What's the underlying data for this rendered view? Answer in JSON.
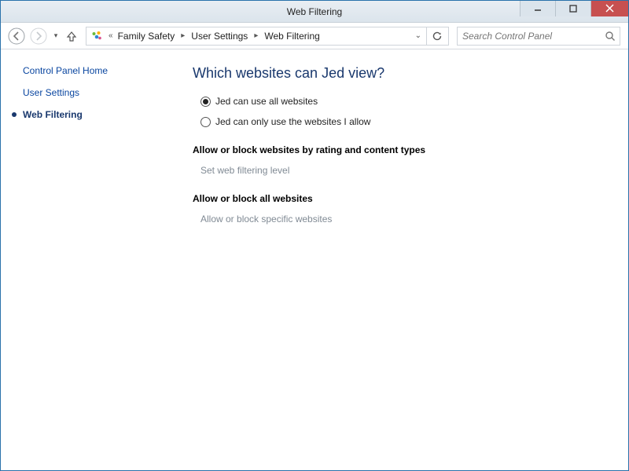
{
  "window": {
    "title": "Web Filtering"
  },
  "breadcrumb": {
    "segments": [
      "Family Safety",
      "User Settings",
      "Web Filtering"
    ]
  },
  "search": {
    "placeholder": "Search Control Panel"
  },
  "sidebar": {
    "home": "Control Panel Home",
    "user_settings": "User Settings",
    "active": "Web Filtering"
  },
  "content": {
    "heading": "Which websites can Jed view?",
    "radio1": "Jed can use all websites",
    "radio2": "Jed can only use the websites I allow",
    "section1_title": "Allow or block websites by rating and content types",
    "section1_link": "Set web filtering level",
    "section2_title": "Allow or block all websites",
    "section2_link": "Allow or block specific websites"
  }
}
